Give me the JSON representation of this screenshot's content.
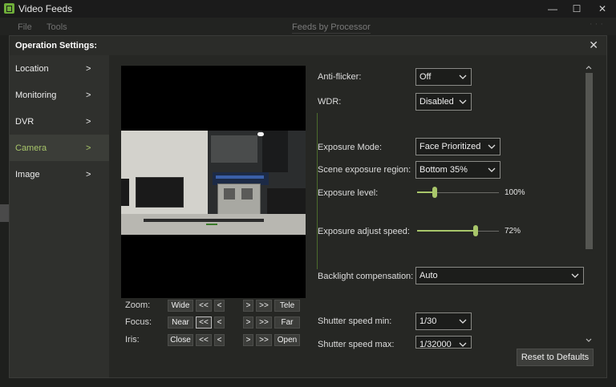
{
  "window": {
    "title": "Video Feeds",
    "controls": {
      "minimize": "—",
      "maximize": "☐",
      "close": "✕"
    }
  },
  "menubar": {
    "items": [
      "File",
      "Tools"
    ],
    "center": "Feeds by Processor",
    "overflow": "· · ·"
  },
  "dialog": {
    "title": "Operation Settings:",
    "close": "✕",
    "sidebar": [
      {
        "label": "Location",
        "chevron": ">"
      },
      {
        "label": "Monitoring",
        "chevron": ">"
      },
      {
        "label": "DVR",
        "chevron": ">"
      },
      {
        "label": "Camera",
        "chevron": ">",
        "active": true
      },
      {
        "label": "Image",
        "chevron": ">"
      }
    ],
    "ptz": {
      "zoom": {
        "label": "Zoom:",
        "left": "Wide",
        "right": "Tele"
      },
      "focus": {
        "label": "Focus:",
        "left": "Near",
        "right": "Far"
      },
      "iris": {
        "label": "Iris:",
        "left": "Close",
        "right": "Open"
      },
      "step_big_left": "<<",
      "step_left": "<",
      "step_right": ">",
      "step_big_right": ">>"
    },
    "settings": {
      "anti_flicker": {
        "label": "Anti-flicker:",
        "value": "Off"
      },
      "wdr": {
        "label": "WDR:",
        "value": "Disabled"
      },
      "exposure_mode": {
        "label": "Exposure Mode:",
        "value": "Face Prioritized"
      },
      "scene_region": {
        "label": "Scene exposure region:",
        "value": "Bottom 35%"
      },
      "exposure_level": {
        "label": "Exposure level:",
        "value_text": "100%",
        "fraction": 0.22
      },
      "exposure_speed": {
        "label": "Exposure adjust speed:",
        "value_text": "72%",
        "fraction": 0.72
      },
      "backlight": {
        "label": "Backlight compensation:",
        "value": "Auto"
      },
      "shutter_min": {
        "label": "Shutter speed min:",
        "value": "1/30"
      },
      "shutter_max": {
        "label": "Shutter speed max:",
        "value": "1/32000"
      }
    },
    "reset_label": "Reset to Defaults"
  },
  "colors": {
    "accent": "#a8c66a",
    "background": "#1e1f1d",
    "panel": "#262724"
  }
}
